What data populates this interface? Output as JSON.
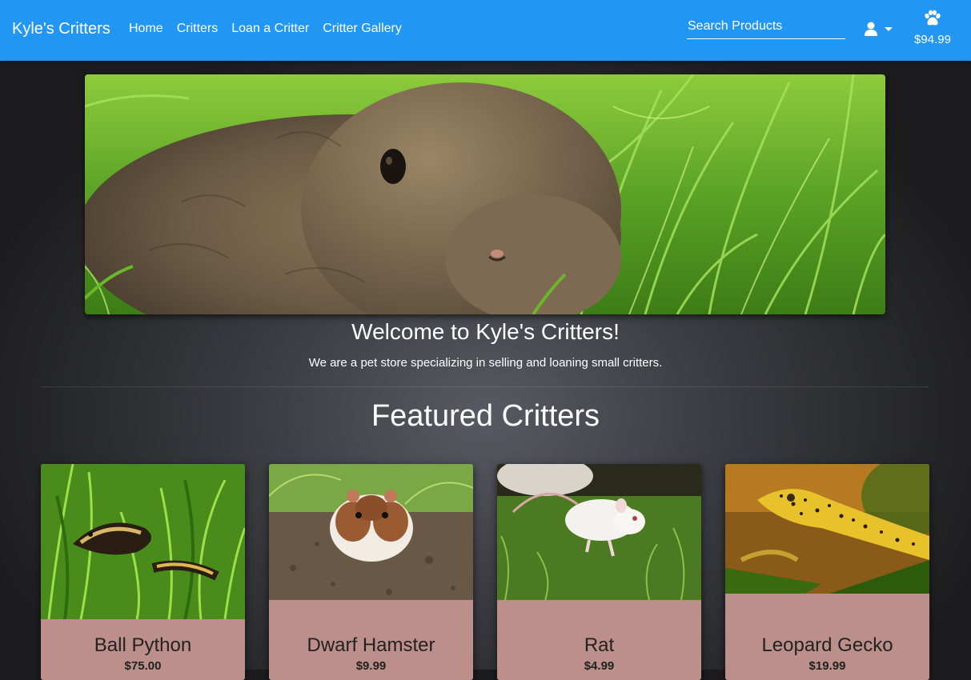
{
  "colors": {
    "nav": "#2196f3",
    "card": "#bc8f8a",
    "text_dark": "#222222"
  },
  "nav": {
    "brand": "Kyle's Critters",
    "links": [
      "Home",
      "Critters",
      "Loan a Critter",
      "Critter Gallery"
    ],
    "search_placeholder": "Search Products",
    "user_icon": "user-icon",
    "user_caret": "caret-down-icon",
    "cart_icon": "paw-icon",
    "cart_total": "$94.99"
  },
  "hero": {
    "image": "rabbit-in-grass-photo"
  },
  "welcome": {
    "title": "Welcome to Kyle's Critters!",
    "text": "We are a pet store specializing in selling and loaning small critters."
  },
  "featured": {
    "title": "Featured Critters",
    "items": [
      {
        "name": "Ball Python",
        "price": "$75.00",
        "image": "ball-python-photo"
      },
      {
        "name": "Dwarf Hamster",
        "price": "$9.99",
        "image": "dwarf-hamster-photo"
      },
      {
        "name": "Rat",
        "price": "$4.99",
        "image": "rat-photo"
      },
      {
        "name": "Leopard Gecko",
        "price": "$19.99",
        "image": "leopard-gecko-photo"
      }
    ]
  }
}
